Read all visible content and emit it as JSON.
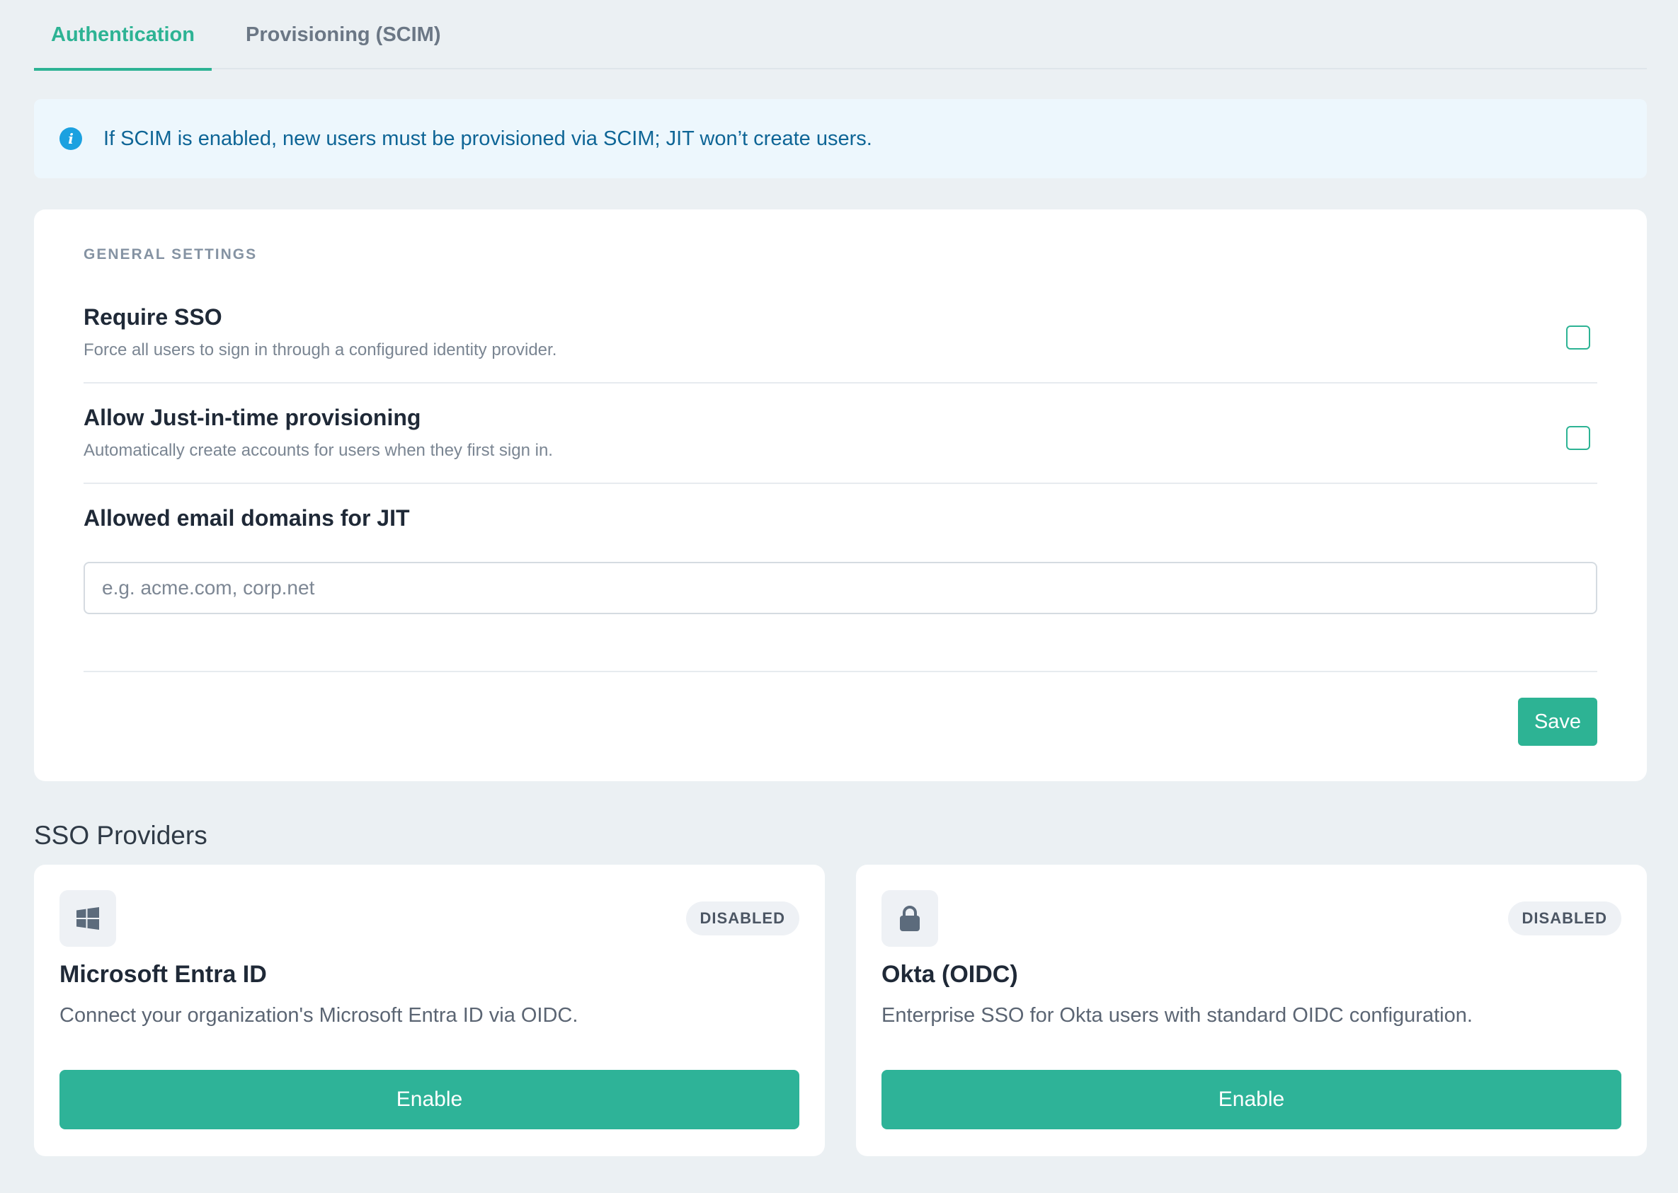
{
  "tabs": [
    {
      "label": "Authentication",
      "active": true
    },
    {
      "label": "Provisioning (SCIM)",
      "active": false
    }
  ],
  "banner": {
    "icon": "info-icon",
    "text": "If SCIM is enabled, new users must be provisioned via SCIM; JIT won’t create users."
  },
  "general": {
    "section_label": "GENERAL SETTINGS",
    "require_sso": {
      "title": "Require SSO",
      "description": "Force all users to sign in through a configured identity provider.",
      "checked": false
    },
    "jit": {
      "title": "Allow Just-in-time provisioning",
      "description": "Automatically create accounts for users when they first sign in.",
      "checked": false
    },
    "domains": {
      "label": "Allowed email domains for JIT",
      "value": "",
      "placeholder": "e.g. acme.com, corp.net"
    },
    "save_label": "Save"
  },
  "sso": {
    "heading": "SSO Providers",
    "providers": [
      {
        "icon": "windows-icon",
        "status": "DISABLED",
        "name": "Microsoft Entra ID",
        "description": "Connect your organization's Microsoft Entra ID via OIDC.",
        "button": "Enable"
      },
      {
        "icon": "lock-icon",
        "status": "DISABLED",
        "name": "Okta (OIDC)",
        "description": "Enterprise SSO for Okta users with standard OIDC configuration.",
        "button": "Enable"
      }
    ]
  },
  "colors": {
    "accent": "#2db394",
    "info": "#1ca1e0",
    "background": "#ebf0f3"
  }
}
